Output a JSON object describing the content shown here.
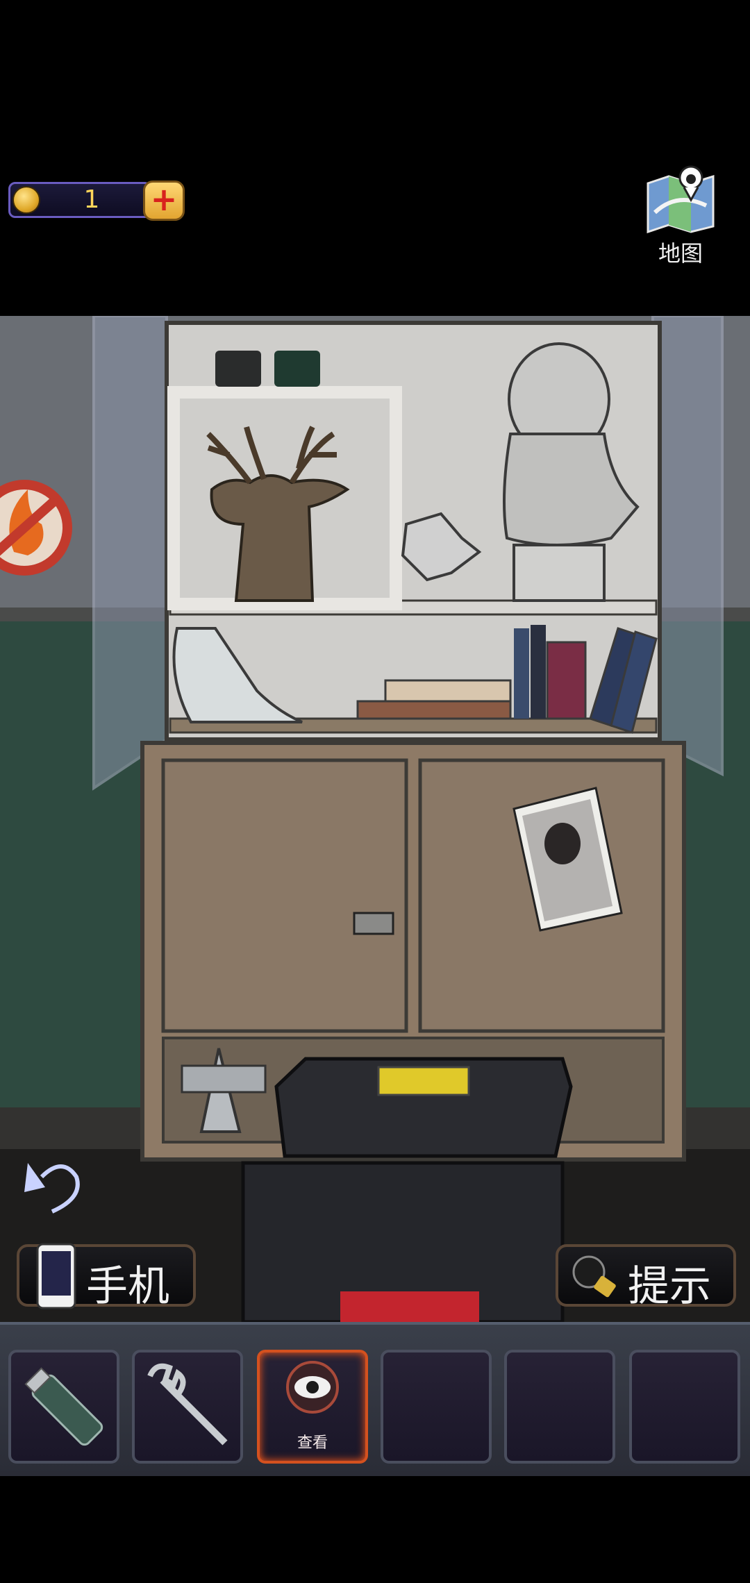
{
  "hud": {
    "coins": "1",
    "map_label": "地图"
  },
  "scene": {
    "description_items": [
      "deer-head",
      "bust",
      "books",
      "photo",
      "toolbox",
      "cone"
    ]
  },
  "buttons": {
    "phone_label": "手机",
    "hint_label": "提示"
  },
  "inventory": {
    "selected_label": "查看"
  }
}
